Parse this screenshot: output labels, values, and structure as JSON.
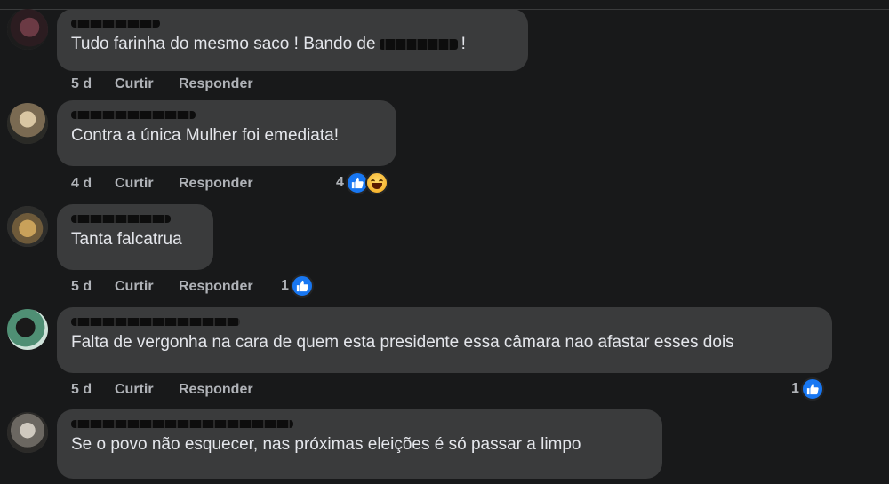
{
  "actions": {
    "like_label": "Curtir",
    "reply_label": "Responder"
  },
  "colors": {
    "background": "#18191a",
    "bubble": "#3a3b3c",
    "meta_text": "#b0b3b8",
    "like_blue": "#1877f2"
  },
  "comments": [
    {
      "text_before": "Tudo farinha do mesmo saco ! Bando de",
      "text_after": "!",
      "age": "5 d",
      "reactions": null
    },
    {
      "text": "Contra a única Mulher foi emediata!",
      "age": "4 d",
      "reactions": {
        "count": "4",
        "icons": [
          "like-icon",
          "haha-icon"
        ]
      }
    },
    {
      "text": "Tanta falcatrua",
      "age": "5 d",
      "reactions": {
        "count": "1",
        "icons": [
          "like-icon"
        ]
      }
    },
    {
      "text": "Falta de vergonha na cara de quem esta presidente essa câmara nao afastar esses dois",
      "age": "5 d",
      "reactions": {
        "count": "1",
        "icons": [
          "like-icon"
        ]
      }
    },
    {
      "text": "Se o povo não esquecer, nas próximas eleições é só passar a limpo",
      "age": null,
      "reactions": null
    }
  ]
}
